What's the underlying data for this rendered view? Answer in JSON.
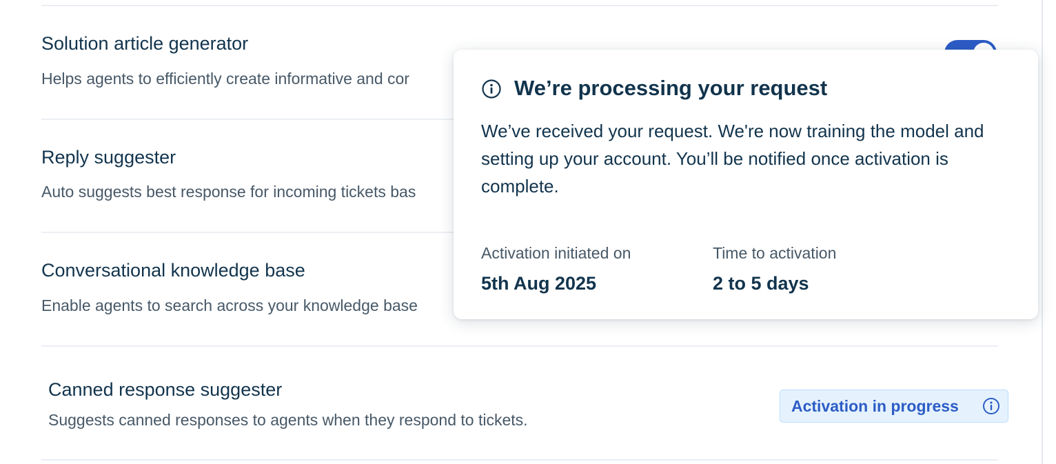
{
  "features": [
    {
      "title": "Solution article generator",
      "description": "Helps agents to efficiently create informative and cor"
    },
    {
      "title": "Reply suggester",
      "description": "Auto suggests best response for incoming tickets bas"
    },
    {
      "title": "Conversational knowledge base",
      "description": "Enable agents to search across your knowledge base"
    },
    {
      "title": "Canned response suggester",
      "description": "Suggests canned responses to agents when they respond to tickets."
    }
  ],
  "solution_article_toggle": {
    "state": "on",
    "color": "#2c5cc5"
  },
  "status_badge": {
    "label": "Activation in progress",
    "icon": "info-icon"
  },
  "popover": {
    "icon": "info-icon",
    "title": "We’re processing your request",
    "body": "We’ve received your request. We're now training the model and setting up your account. You’ll be notified once activation is complete.",
    "activation_initiated_label": "Activation initiated on",
    "activation_initiated_value": "5th Aug 2025",
    "time_to_activation_label": "Time to activation",
    "time_to_activation_value": "2 to 5 days"
  },
  "colors": {
    "text_primary": "#12344d",
    "text_secondary": "#475867",
    "accent": "#2c5cc5",
    "badge_bg": "#e5f2fd",
    "badge_border": "#bbdcfe"
  }
}
